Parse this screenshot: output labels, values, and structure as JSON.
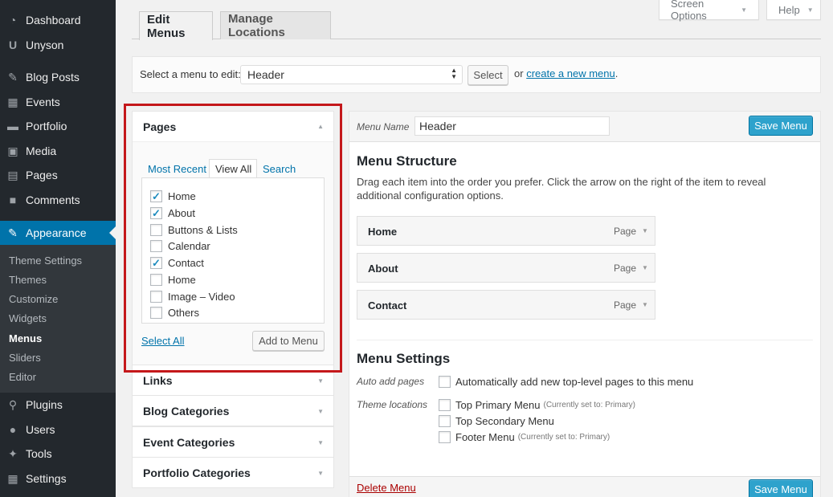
{
  "sidebar": {
    "items": [
      {
        "label": "Dashboard",
        "icon": "dashboard-icon"
      },
      {
        "label": "Unyson",
        "icon": "unyson-icon"
      },
      {
        "label": "Blog Posts",
        "icon": "pin-icon"
      },
      {
        "label": "Events",
        "icon": "calendar-icon"
      },
      {
        "label": "Portfolio",
        "icon": "folder-icon"
      },
      {
        "label": "Media",
        "icon": "media-icon"
      },
      {
        "label": "Pages",
        "icon": "pages-icon"
      },
      {
        "label": "Comments",
        "icon": "comments-icon"
      },
      {
        "label": "Appearance",
        "icon": "appearance-icon"
      },
      {
        "label": "Plugins",
        "icon": "plugins-icon"
      },
      {
        "label": "Users",
        "icon": "users-icon"
      },
      {
        "label": "Tools",
        "icon": "tools-icon"
      },
      {
        "label": "Settings",
        "icon": "settings-icon"
      }
    ],
    "submenu": [
      "Theme Settings",
      "Themes",
      "Customize",
      "Widgets",
      "Menus",
      "Sliders",
      "Editor"
    ]
  },
  "header": {
    "screen_options": "Screen Options",
    "help": "Help",
    "tabs": [
      "Edit Menus",
      "Manage Locations"
    ]
  },
  "select_bar": {
    "label": "Select a menu to edit:",
    "selected": "Header",
    "button": "Select",
    "or": "or",
    "create_link": "create a new menu",
    "period": "."
  },
  "left": {
    "pages_title": "Pages",
    "page_tabs": [
      "Most Recent",
      "View All",
      "Search"
    ],
    "pages": [
      {
        "label": "Home",
        "checked": true
      },
      {
        "label": "About",
        "checked": true
      },
      {
        "label": "Buttons & Lists",
        "checked": false
      },
      {
        "label": "Calendar",
        "checked": false
      },
      {
        "label": "Contact",
        "checked": true
      },
      {
        "label": "Home",
        "checked": false
      },
      {
        "label": "Image – Video",
        "checked": false
      },
      {
        "label": "Others",
        "checked": false
      }
    ],
    "select_all": "Select All",
    "add_button": "Add to Menu",
    "sections": [
      "Links",
      "Blog Categories",
      "Event Categories",
      "Portfolio Categories"
    ]
  },
  "editor": {
    "menu_name_label": "Menu Name",
    "menu_name_value": "Header",
    "save_label": "Save Menu",
    "structure_title": "Menu Structure",
    "structure_desc": "Drag each item into the order you prefer. Click the arrow on the right of the item to reveal additional configuration options.",
    "items": [
      {
        "title": "Home",
        "type": "Page"
      },
      {
        "title": "About",
        "type": "Page"
      },
      {
        "title": "Contact",
        "type": "Page"
      }
    ],
    "settings_title": "Menu Settings",
    "auto_add_label": "Auto add pages",
    "auto_add_text": "Automatically add new top-level pages to this menu",
    "theme_locations_label": "Theme locations",
    "locations": [
      {
        "label": "Top Primary Menu",
        "note": "(Currently set to: Primary)"
      },
      {
        "label": "Top Secondary Menu",
        "note": ""
      },
      {
        "label": "Footer Menu",
        "note": "(Currently set to: Primary)"
      }
    ],
    "delete_label": "Delete Menu"
  },
  "colors": {
    "sidebar": "#23282d",
    "accent": "#0073aa",
    "highlight": "#c4181b",
    "primary_button": "#2ea2cc"
  }
}
